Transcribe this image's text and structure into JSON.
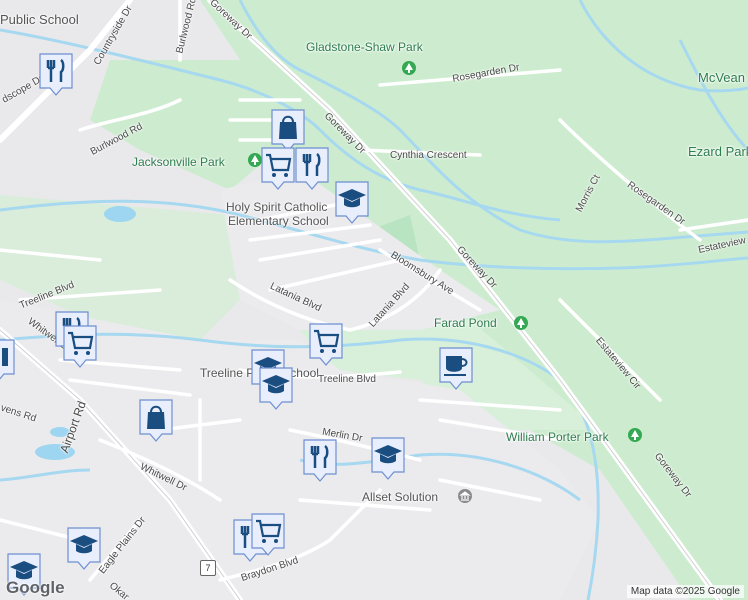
{
  "map": {
    "area_labels": {
      "public_school_top": "Public School",
      "gladstone_shaw_park": "Gladstone-Shaw Park",
      "mcvean": "McVean",
      "ezard_park": "Ezard Park",
      "jacksonville_park": "Jacksonville Park",
      "holy_spirit_line1": "Holy Spirit Catholic",
      "holy_spirit_line2": "Elementary School",
      "farad_pond": "Farad Pond",
      "treeline_public_school": "Treeline Public School",
      "william_porter_park": "William Porter Park",
      "allset_solution": "Allset Solution",
      "cynthia_crescent": "Cynthia Crescent"
    },
    "road_labels": {
      "goreway_dr_1": "Goreway Dr",
      "goreway_dr_2": "Goreway Dr",
      "goreway_dr_3": "Goreway Dr",
      "goreway_dr_4": "Goreway Dr",
      "rosegarden_dr_1": "Rosegarden Dr",
      "rosegarden_dr_2": "Rosegarden Dr",
      "morris_ct": "Morris Ct",
      "estateview_1": "Estateview",
      "estateview_cir": "Estateview Cir",
      "burlwood_rd_1": "Burlwood Rd",
      "burlwood_rd_2": "Burlwood Rd",
      "countryside_dr": "Countryside Dr",
      "landscape_dr": "dscope Dr",
      "bloomsbury_ave": "Bloomsbury Ave",
      "latania_blvd_1": "Latania Blvd",
      "latania_blvd_2": "Latania Blvd",
      "treeline_blvd_1": "Treeline Blvd",
      "treeline_blvd_2": "Treeline Blvd",
      "whitwell_dr_1": "Whitwell Dr",
      "whitwell_dr_2": "Whitwell Dr",
      "stevens_rd": "vens Rd",
      "airport_rd": "Airport Rd",
      "merlin_dr": "Merlin Dr",
      "eagle_plains_dr": "Eagle Plains Dr",
      "braydon_blvd": "Braydon Blvd",
      "okar": "Okar"
    },
    "route_shield": "7",
    "credit": "Map data ©2025 Google",
    "logo": "Google",
    "markers": [
      {
        "icon": "restaurant-icon"
      },
      {
        "icon": "shopping-bag-icon"
      },
      {
        "icon": "shopping-cart-icon"
      },
      {
        "icon": "restaurant-icon"
      },
      {
        "icon": "school-icon"
      },
      {
        "icon": "restaurant-icon"
      },
      {
        "icon": "shopping-cart-icon"
      },
      {
        "icon": "shopping-cart-icon"
      },
      {
        "icon": "school-icon"
      },
      {
        "icon": "school-icon"
      },
      {
        "icon": "cafe-icon"
      },
      {
        "icon": "shopping-bag-icon"
      },
      {
        "icon": "restaurant-icon"
      },
      {
        "icon": "school-icon"
      },
      {
        "icon": "restaurant-icon"
      },
      {
        "icon": "shopping-cart-icon"
      },
      {
        "icon": "school-icon"
      },
      {
        "icon": "school-icon"
      }
    ],
    "colors": {
      "park": "#c8ebcf",
      "water": "#9ed5f0",
      "road": "#ffffff",
      "marker": "#e8eefc",
      "icon": "#1a4d80"
    }
  }
}
